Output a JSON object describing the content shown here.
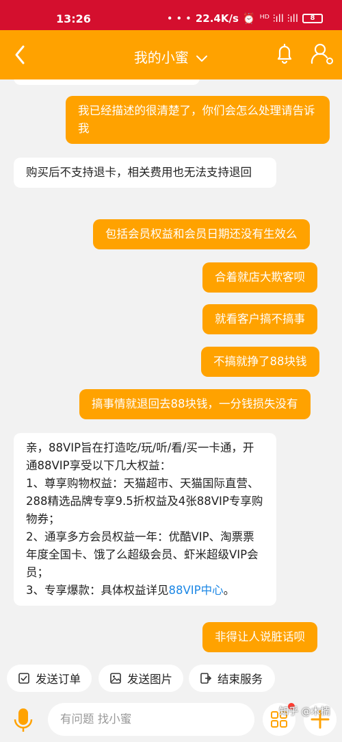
{
  "status": {
    "time": "13:26",
    "dots": "• • •",
    "speed": "22.4K/s",
    "signal": "ᴴᴰ ⫶ıll ⫶ıll",
    "battery": "8"
  },
  "header": {
    "title": "我的小蜜"
  },
  "messages": [
    {
      "role": "user",
      "text": "我已经描述的很清楚了，你们会怎么处理请告诉我"
    },
    {
      "role": "agent",
      "text": "购买后不支持退卡，相关费用也无法支持退回"
    },
    {
      "role": "user",
      "text": "包括会员权益和会员日期还没有生效么"
    },
    {
      "role": "user",
      "text": "合着就店大欺客呗"
    },
    {
      "role": "user",
      "text": "就看客户搞不搞事"
    },
    {
      "role": "user",
      "text": "不搞就挣了88块钱"
    },
    {
      "role": "user",
      "text": "搞事情就退回去88块钱，一分钱损失没有"
    },
    {
      "role": "agent",
      "text": "亲，88VIP旨在打造吃/玩/听/看/买一卡通，开通88VIP享受以下几大权益：\n1、尊享购物权益：天猫超市、天猫国际直营、288精选品牌专享9.5折权益及4张88VIP专享购物券；\n2、通享多方会员权益一年：优酷VIP、淘票票年度全国卡、饿了么超级会员、虾米超级VIP会员；\n3、专享爆款：具体权益详见",
      "link": "88VIP中心",
      "suffix": "。"
    },
    {
      "role": "user",
      "text": "非得让人说脏话呗"
    }
  ],
  "quick_actions": [
    {
      "label": "发送订单",
      "icon": "order-icon"
    },
    {
      "label": "发送图片",
      "icon": "image-icon"
    },
    {
      "label": "结束服务",
      "icon": "exit-icon"
    }
  ],
  "input": {
    "placeholder": "有问题 找小蜜"
  },
  "watermark": "知乎 @木楠",
  "colors": {
    "status_bar": "#d40f2e",
    "accent": "#ffa200",
    "link": "#1e88e5"
  }
}
